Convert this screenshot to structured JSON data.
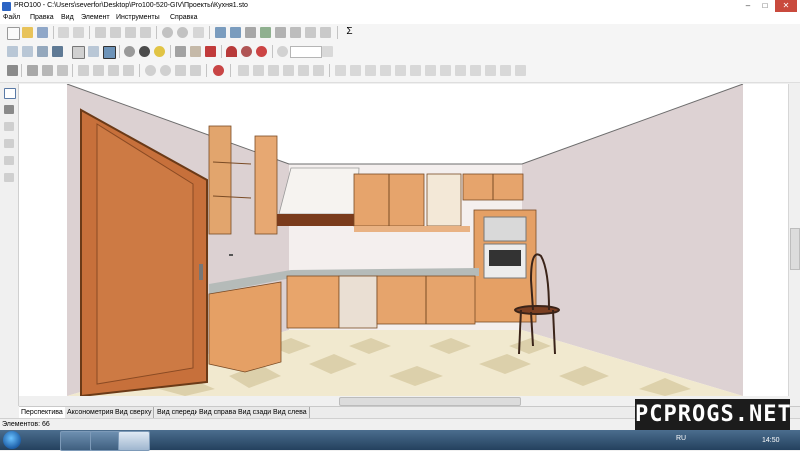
{
  "window": {
    "title": "PRO100 - C:\\Users\\severfor\\Desktop\\Pro100-520-GIV\\Проекты\\Кухня1.sto",
    "minimize": "–",
    "maximize": "□",
    "close": "✕"
  },
  "menu": [
    "Файл",
    "Правка",
    "Вид",
    "Элемент",
    "Инструменты",
    "Справка"
  ],
  "toolbar": {
    "zoom_value": "",
    "sigma": "Σ"
  },
  "view_tabs": [
    "Перспектива",
    "Аксонометрия",
    "Вид сверху",
    "Вид спереди",
    "Вид справа",
    "Вид сзади",
    "Вид слева"
  ],
  "active_tab": 0,
  "status": {
    "elements": "Элементов: 66"
  },
  "taskbar": {
    "language": "RU",
    "time": "14:50"
  },
  "watermark": "PCPROGS.NET",
  "icons": [
    "start-orb-icon",
    "explorer-icon",
    "folder-icon",
    "pro100-icon",
    "cursor-icon",
    "magnet-icon",
    "zoom-icon"
  ],
  "colors": {
    "wood": "#e5a065",
    "door": "#c7703b",
    "floor_light": "#f3ecd3",
    "floor_tile": "#dccfaa",
    "wall": "#ddd2d3",
    "ceiling": "#ffffff",
    "countertop": "#b5bbb9",
    "taskbar": "#2c4b6b"
  }
}
